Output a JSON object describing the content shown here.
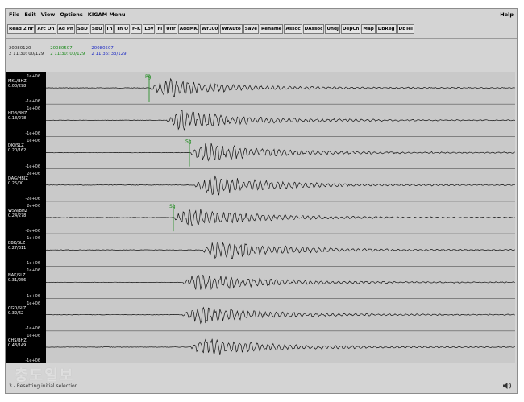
{
  "menu": {
    "items": [
      "File",
      "Edit",
      "View",
      "Options",
      "KIGAM Menu"
    ],
    "help": "Help"
  },
  "toolbar": {
    "buttons": [
      "Read 2 hr",
      "Arc On",
      "Ad Ph",
      "SBD",
      "SBU",
      "Th",
      "Th O",
      "F-K",
      "Lov",
      "Fl",
      "Ulfr",
      "AddMK",
      "Wf100",
      "WfAuto",
      "Save",
      "Rename",
      "Assoc",
      "DAssoc",
      "Undj",
      "DepCh",
      "Map",
      "DbReg",
      "DbTel"
    ]
  },
  "timestamps": [
    {
      "date": "20080120",
      "time": "2 11:30: 00/129",
      "color": "#222222"
    },
    {
      "date": "20080507",
      "time": "2 11:30: 00/129",
      "color": "#1b8a1b"
    },
    {
      "date": "20080507",
      "time": "2 11:36: 33/129",
      "color": "#1b29c4"
    }
  ],
  "stations": [
    {
      "name": "MKL/BHZ",
      "dist": "0.00/298",
      "scale_top": "1e+06",
      "scale_bot": "-1e+06",
      "phase": "Pg",
      "phase_color": "#1b8a1b"
    },
    {
      "name": "HDB/BHZ",
      "dist": "0.18/278",
      "scale_top": "1e+06",
      "scale_bot": "-1e+06"
    },
    {
      "name": "DKJ/SLZ",
      "dist": "0.20/162",
      "scale_top": "1e+06",
      "scale_bot": "-1e+06",
      "phase": "Sg",
      "phase_color": "#1b8a1b"
    },
    {
      "name": "DAG/HBIZ",
      "dist": "0.25/00",
      "scale_top": "2e+06",
      "scale_bot": "-2e+06"
    },
    {
      "name": "WSN/BHZ",
      "dist": "0.24/278",
      "scale_top": "2e+06",
      "scale_bot": "-2e+06",
      "phase": "Sg",
      "phase_color": "#1b8a1b"
    },
    {
      "name": "BBK/SLZ",
      "dist": "0.27/311",
      "scale_top": "1e+06",
      "scale_bot": "-1e+06"
    },
    {
      "name": "NAK/SLZ",
      "dist": "0.31/256",
      "scale_top": "1e+06",
      "scale_bot": "-1e+06"
    },
    {
      "name": "CGD/SLZ",
      "dist": "0.32/62",
      "scale_top": "1e+06",
      "scale_bot": "-1e+06"
    },
    {
      "name": "CHS/BHZ",
      "dist": "0.43/149",
      "scale_top": "1e+06",
      "scale_bot": "-1e+06"
    }
  ],
  "status": {
    "message": "3 - Resetting initial selection"
  },
  "watermark": "충도일보"
}
